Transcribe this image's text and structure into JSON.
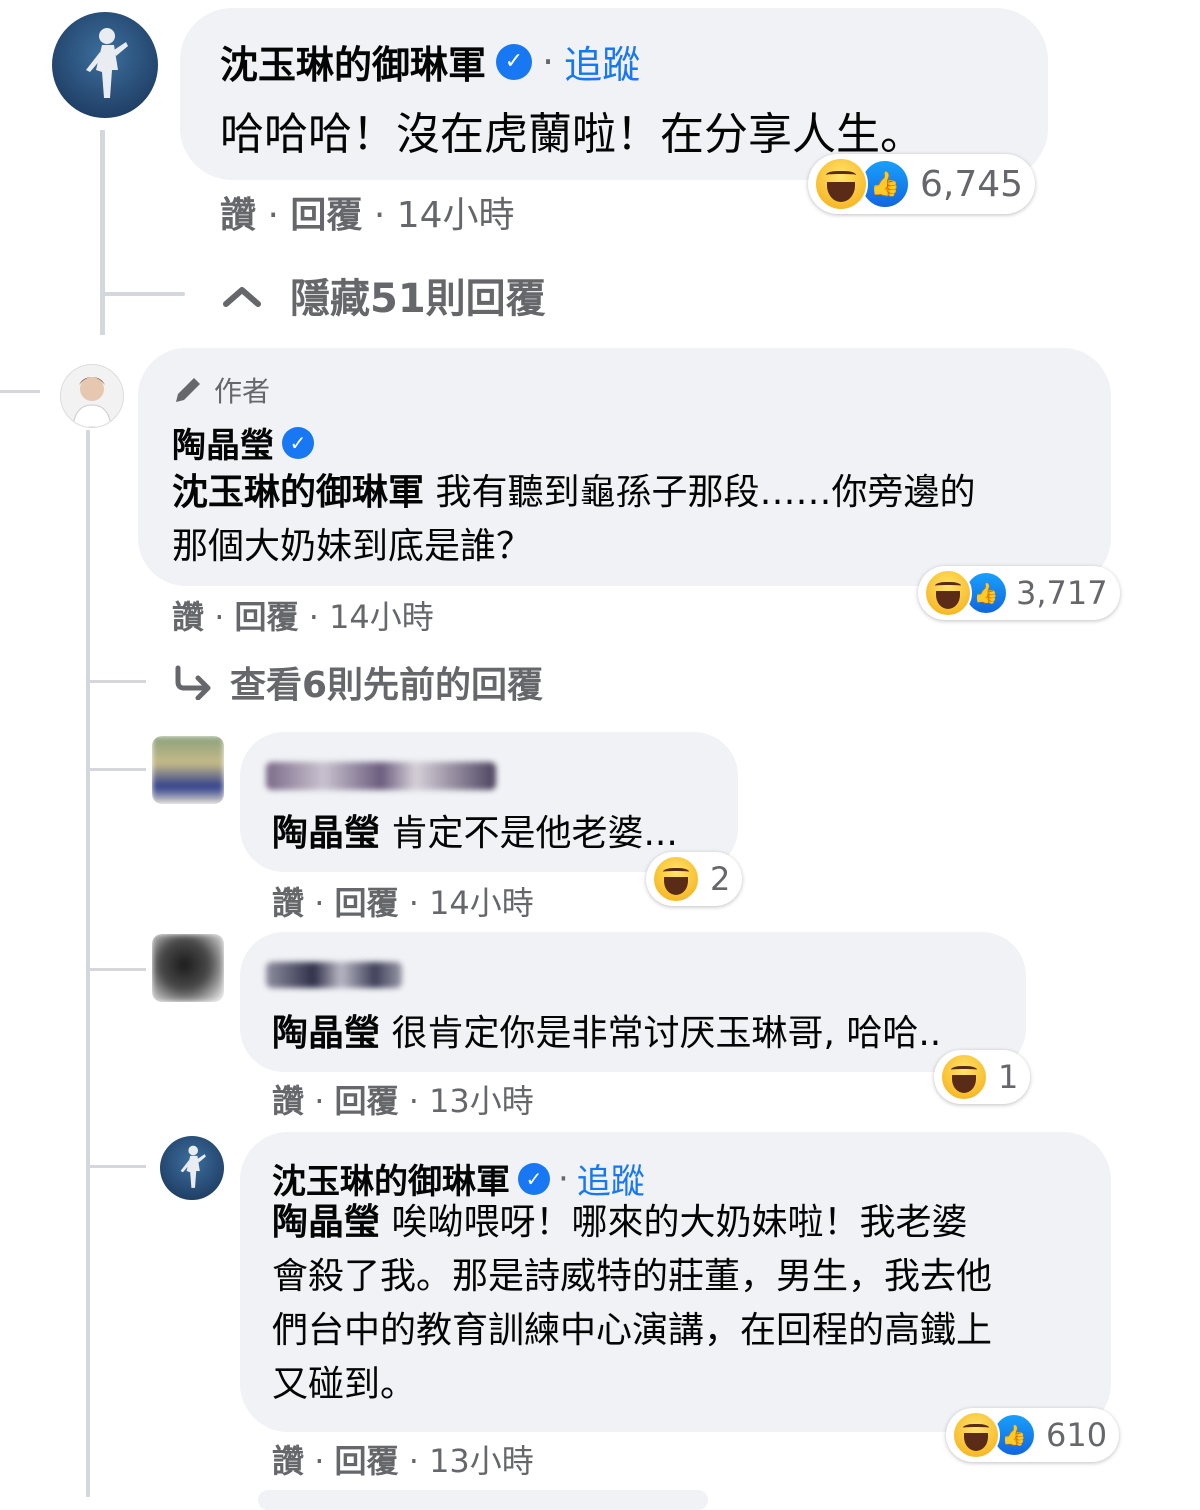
{
  "comment_main": {
    "author": "沈玉琳的御琳軍",
    "verified": true,
    "follow_label": "追蹤",
    "separator": "·",
    "text": "哈哈哈！沒在虎蘭啦！在分享人生。",
    "actions": {
      "like": "讚",
      "reply": "回覆",
      "time": "14小時"
    },
    "reaction_count": "6,745"
  },
  "hide_replies": {
    "label": "隱藏51則回覆",
    "icon": "chevron-up-icon"
  },
  "reply_author_post": {
    "badge_label": "作者",
    "badge_icon": "pencil-icon",
    "author": "陶晶瑩",
    "verified": true,
    "mention": "沈玉琳的御琳軍",
    "text_line1": "我有聽到龜孫子那段……你旁邊的",
    "text_line2": "那個大奶妹到底是誰？",
    "actions": {
      "like": "讚",
      "reply": "回覆",
      "time": "14小時"
    },
    "reaction_count": "3,717"
  },
  "view_previous": {
    "label": "查看6則先前的回覆",
    "icon": "reply-arrow-icon"
  },
  "reply_1": {
    "mention": "陶晶瑩",
    "text": "肯定不是他老婆...",
    "actions": {
      "like": "讚",
      "reply": "回覆",
      "time": "14小時"
    },
    "reaction_count": "2"
  },
  "reply_2": {
    "mention": "陶晶瑩",
    "text": "很肯定你是非常讨厌玉琳哥, 哈哈..",
    "actions": {
      "like": "讚",
      "reply": "回覆",
      "time": "13小時"
    },
    "reaction_count": "1"
  },
  "reply_3": {
    "author": "沈玉琳的御琳軍",
    "verified": true,
    "follow_label": "追蹤",
    "mention": "陶晶瑩",
    "text_line1": "唉呦喂呀！哪來的大奶妹啦！我老婆",
    "text_line2": "會殺了我。那是詩威特的莊董，男生，我去他",
    "text_line3": "們台中的教育訓練中心演講，在回程的高鐵上",
    "text_line4": "又碰到。",
    "actions": {
      "like": "讚",
      "reply": "回覆",
      "time": "13小時"
    },
    "reaction_count": "610"
  },
  "colors": {
    "bubble": "#f0f2f5",
    "link_blue": "#1877f2",
    "meta_gray": "#65676b",
    "thread_line": "#d4d7dc"
  }
}
